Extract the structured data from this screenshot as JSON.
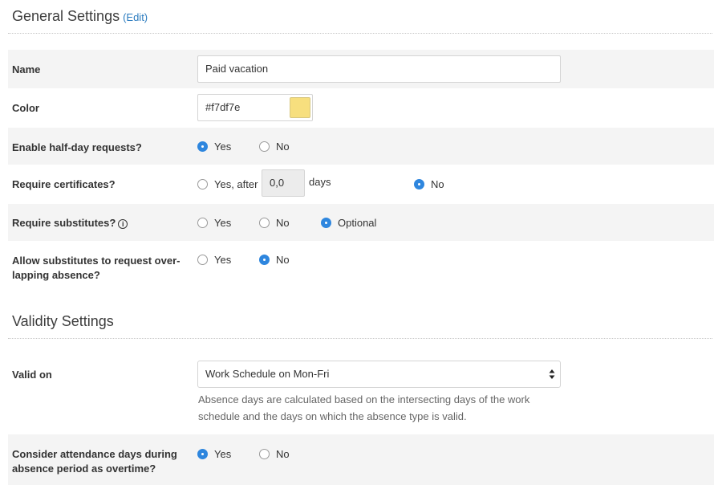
{
  "general": {
    "title": "General Settings",
    "edit_label": "(Edit)"
  },
  "name_row": {
    "label": "Name",
    "value": "Paid vacation"
  },
  "color_row": {
    "label": "Color",
    "value": "#f7df7e",
    "swatch_color": "#f7df7e"
  },
  "half_day_row": {
    "label": "Enable half-day requests?",
    "yes": "Yes",
    "no": "No",
    "selected": "yes"
  },
  "certificates_row": {
    "label": "Require certificates?",
    "yes_after": "Yes, after",
    "days_value": "0,0",
    "days_unit": "days",
    "no": "No",
    "selected": "no"
  },
  "substitutes_row": {
    "label": "Require substitutes?",
    "info_icon": "info-icon",
    "yes": "Yes",
    "no": "No",
    "optional": "Optional",
    "selected": "optional"
  },
  "overlap_row": {
    "label_line1": "Allow substitutes to request over-",
    "label_line2": "lapping absence?",
    "yes": "Yes",
    "no": "No",
    "selected": "no"
  },
  "validity": {
    "title": "Validity Settings"
  },
  "valid_on_row": {
    "label": "Valid on",
    "selected_option": "Work Schedule on Mon-Fri",
    "help_line1": "Absence days are calculated based on the intersecting days of the work",
    "help_line2": "schedule and the days on which the absence type is valid."
  },
  "overtime_row": {
    "label_line1": "Consider attendance days during",
    "label_line2": "absence period as overtime?",
    "yes": "Yes",
    "no": "No",
    "selected": "yes"
  },
  "colors": {
    "accent": "#2e86de",
    "link": "#2b7bbf",
    "row_shade": "#f4f4f4"
  }
}
